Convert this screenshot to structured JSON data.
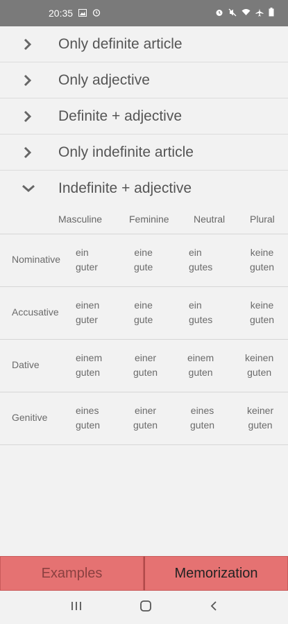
{
  "status_bar": {
    "time": "20:35",
    "left_icons": [
      "image-icon",
      "alarm-icon"
    ],
    "right_icons": [
      "alarm-icon",
      "mute-icon",
      "wifi-icon",
      "airplane-icon",
      "battery-icon"
    ]
  },
  "sections": [
    {
      "label": "Only definite article",
      "expanded": false
    },
    {
      "label": "Only adjective",
      "expanded": false
    },
    {
      "label": "Definite + adjective",
      "expanded": false
    },
    {
      "label": "Only indefinite article",
      "expanded": false
    },
    {
      "label": "Indefinite + adjective",
      "expanded": true
    }
  ],
  "table": {
    "columns": [
      "Masculine",
      "Feminine",
      "Neutral",
      "Plural"
    ],
    "rows": [
      {
        "case": "Nominative",
        "cells": [
          [
            "ein",
            "guter"
          ],
          [
            "eine",
            "gute"
          ],
          [
            "ein",
            "gutes"
          ],
          [
            "keine",
            "guten"
          ]
        ]
      },
      {
        "case": "Accusative",
        "cells": [
          [
            "einen",
            "guter"
          ],
          [
            "eine",
            "gute"
          ],
          [
            "ein",
            "gutes"
          ],
          [
            "keine",
            "guten"
          ]
        ]
      },
      {
        "case": "Dative",
        "cells": [
          [
            "einem",
            "guten"
          ],
          [
            "einer",
            "guten"
          ],
          [
            "einem",
            "guten"
          ],
          [
            "keinen",
            "guten"
          ]
        ]
      },
      {
        "case": "Genitive",
        "cells": [
          [
            "eines",
            "guten"
          ],
          [
            "einer",
            "guten"
          ],
          [
            "eines",
            "guten"
          ],
          [
            "keiner",
            "guten"
          ]
        ]
      }
    ]
  },
  "bottom_buttons": {
    "examples": "Examples",
    "memorization": "Memorization"
  },
  "colors": {
    "status_bar": "#7a7a7a",
    "button_bg": "#e57272",
    "background": "#f2f2f2"
  }
}
